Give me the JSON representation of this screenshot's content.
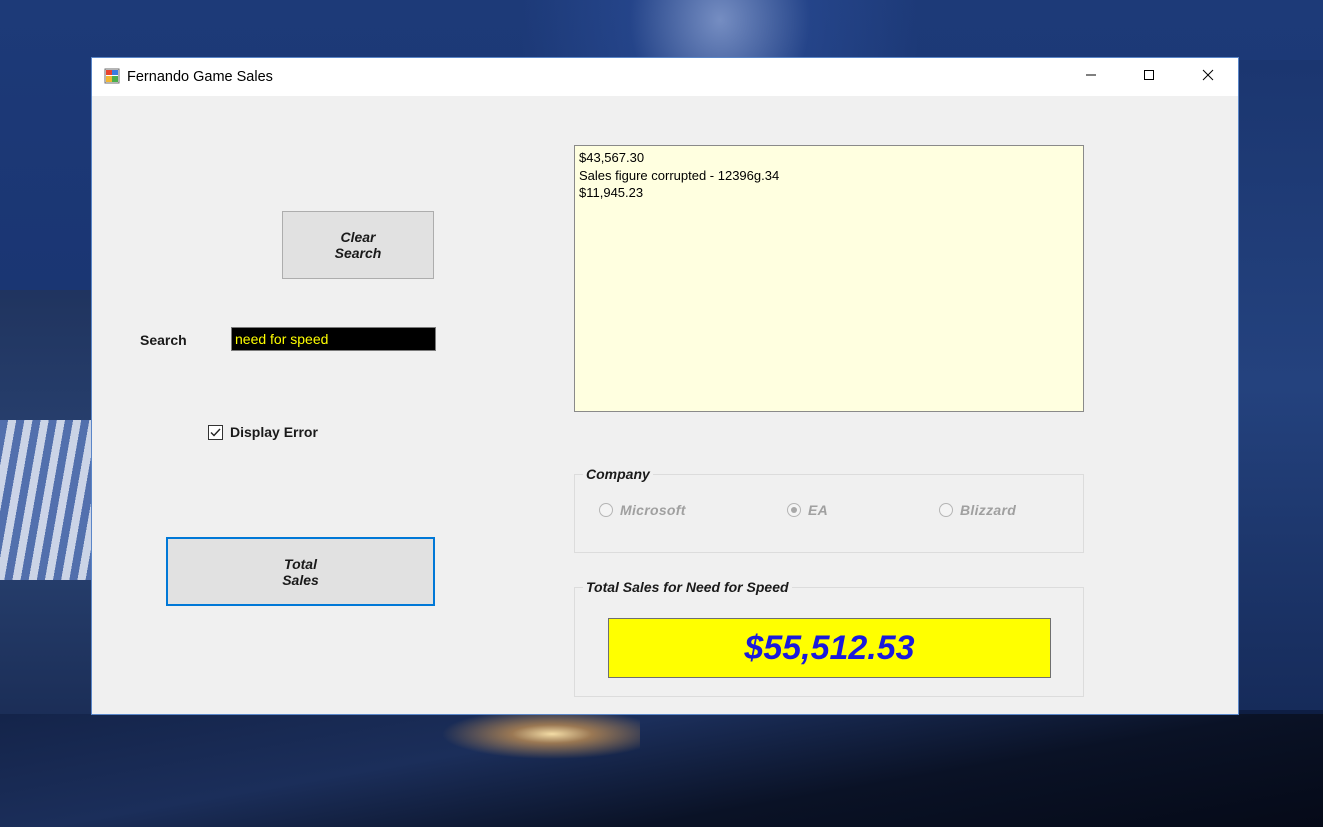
{
  "window": {
    "title": "Fernando Game Sales",
    "icon": "winforms-app-icon",
    "controls": [
      "minimize-icon",
      "maximize-icon",
      "close-icon"
    ]
  },
  "buttons": {
    "clear_search": "Clear\nSearch",
    "total_sales": "Total\nSales"
  },
  "search": {
    "label": "Search",
    "value": "need for speed",
    "colors": {
      "background": "#000000",
      "text": "#ffff00"
    }
  },
  "display_error": {
    "label": "Display Error",
    "checked": true
  },
  "results": {
    "lines": [
      "$43,567.30",
      "Sales figure corrupted - 12396g.34",
      "$11,945.23"
    ],
    "background": "#ffffe0"
  },
  "company": {
    "title": "Company",
    "options": [
      {
        "label": "Microsoft",
        "selected": false
      },
      {
        "label": "EA",
        "selected": true
      },
      {
        "label": "Blizzard",
        "selected": false
      }
    ],
    "enabled": false
  },
  "total": {
    "title": "Total Sales for Need for Speed",
    "value": "$55,512.53",
    "colors": {
      "background": "#ffff00",
      "text": "#1a1adb"
    }
  }
}
